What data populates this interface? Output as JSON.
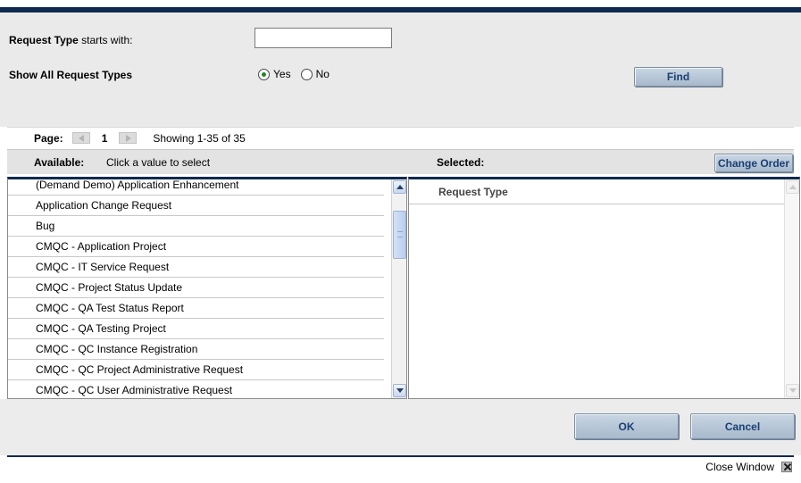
{
  "filters": {
    "request_type_label_bold": "Request Type",
    "request_type_label_rest": " starts with:",
    "request_type_value": "",
    "show_all_label": "Show All Request Types",
    "yes_label": "Yes",
    "no_label": "No",
    "selected_option": "Yes",
    "find_label": "Find"
  },
  "pager": {
    "page_label": "Page:",
    "current_page": "1",
    "showing_text": "Showing 1-35 of 35"
  },
  "available": {
    "label": "Available:",
    "hint": "Click a value to select",
    "items": [
      "(Demand Demo) Application Enhancement",
      "Application Change Request",
      "Bug",
      "CMQC - Application Project",
      "CMQC - IT Service Request",
      "CMQC - Project Status Update",
      "CMQC - QA Test Status Report",
      "CMQC - QA Testing Project",
      "CMQC - QC Instance Registration",
      "CMQC - QC Project Administrative Request",
      "CMQC - QC User Administrative Request"
    ]
  },
  "selected": {
    "label": "Selected:",
    "change_order_label": "Change Order",
    "column_header": "Request Type"
  },
  "actions": {
    "ok_label": "OK",
    "cancel_label": "Cancel"
  },
  "footer": {
    "close_window_label": "Close Window"
  },
  "colors": {
    "header_navy": "#0f2a4e",
    "button_text": "#1b3f73",
    "panel_gray": "#eaeaea"
  }
}
